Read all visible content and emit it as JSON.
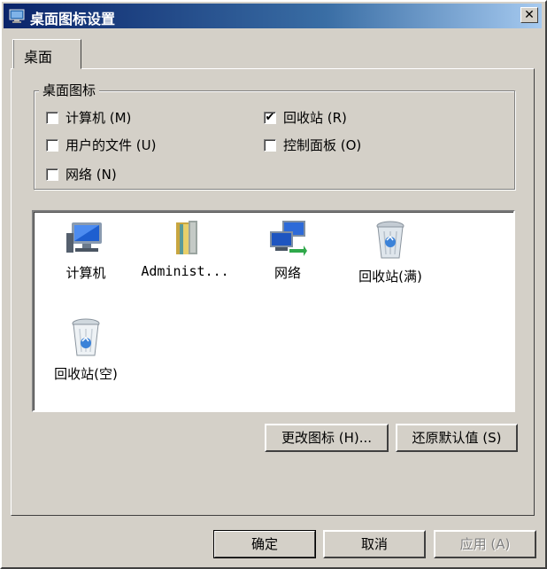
{
  "window": {
    "title": "桌面图标设置",
    "close_label": "✕"
  },
  "tabs": [
    {
      "label": "桌面"
    }
  ],
  "desktop_icons_group": {
    "legend": "桌面图标",
    "checkboxes": [
      {
        "label": "计算机 (M)",
        "checked": false,
        "mark": ""
      },
      {
        "label": "回收站 (R)",
        "checked": true,
        "mark": "✔"
      },
      {
        "label": "用户的文件 (U)",
        "checked": false,
        "mark": ""
      },
      {
        "label": "控制面板 (O)",
        "checked": false,
        "mark": ""
      },
      {
        "label": "网络 (N)",
        "checked": false,
        "mark": ""
      }
    ]
  },
  "icon_list": [
    {
      "label": "计算机",
      "icon": "computer-icon"
    },
    {
      "label": "Administ...",
      "icon": "user-folder-icon"
    },
    {
      "label": "网络",
      "icon": "network-icon"
    },
    {
      "label": "回收站(满)",
      "icon": "recycle-bin-full-icon"
    },
    {
      "label": "回收站(空)",
      "icon": "recycle-bin-empty-icon"
    }
  ],
  "buttons": {
    "change_icon": "更改图标 (H)...",
    "restore_default": "还原默认值 (S)",
    "ok": "确定",
    "cancel": "取消",
    "apply": "应用 (A)"
  },
  "colors": {
    "title_start": "#0a246a",
    "title_end": "#a6caf0",
    "face": "#d4d0c8"
  }
}
